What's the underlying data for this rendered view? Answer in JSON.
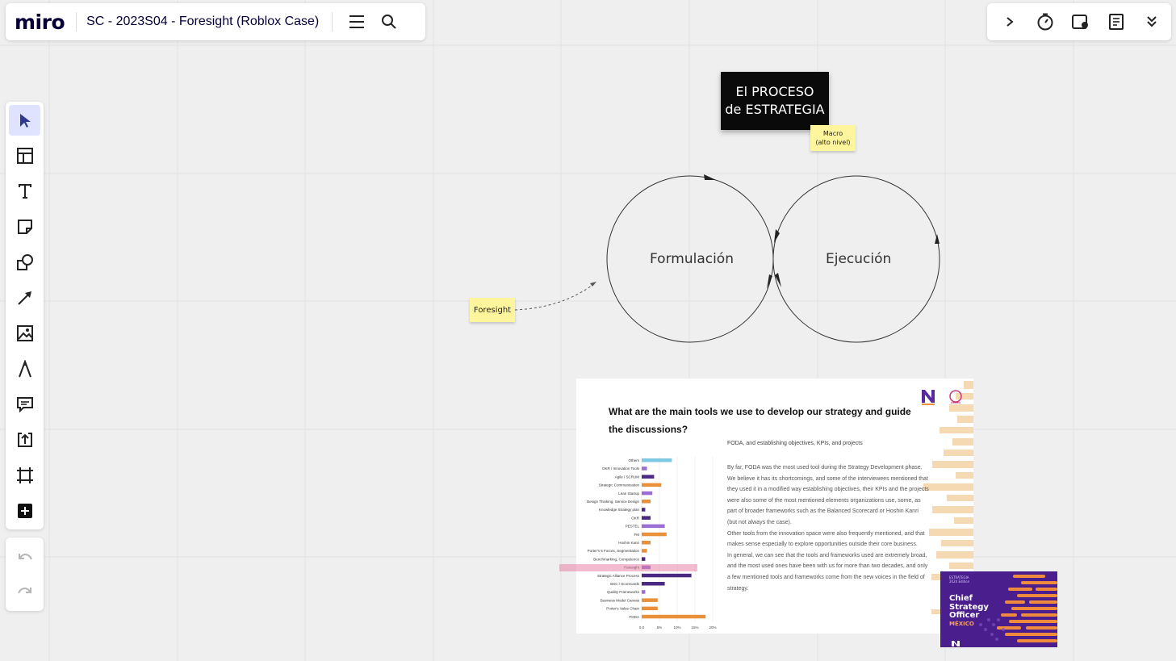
{
  "app": {
    "logo": "miro",
    "board_title": "SC - 2023S04 - Foresight (Roblox Case)"
  },
  "topbar": {
    "menu_icon": "hamburger-icon",
    "search_icon": "search-icon"
  },
  "rightbar": {
    "icons": [
      "chevron-right-icon",
      "timer-icon",
      "board-present-icon",
      "notes-icon",
      "chevrons-down-icon"
    ]
  },
  "toolbar": {
    "tools": [
      "select",
      "templates",
      "text",
      "sticky-note",
      "shapes",
      "arrow",
      "image",
      "pen",
      "comment",
      "upload",
      "frame",
      "add"
    ]
  },
  "canvas": {
    "title_card": {
      "line1": "El PROCESO",
      "line2": "de ESTRATEGIA"
    },
    "sticky_macro": {
      "line1": "Macro",
      "line2": "(alto nivel)"
    },
    "sticky_foresight": "Foresight",
    "circle_left": "Formulación",
    "circle_right": "Ejecución"
  },
  "slide": {
    "question": "What are the main tools we use to develop our strategy and guide the discussions?",
    "subtitle": "FODA, and establishing objectives, KPIs, and projects",
    "paragraphs": [
      "By far, FODA was the most used tool during the Strategy Development phase. We believe it has its shortcomings, and some of the interviewees mentioned that they used it in a modified way establishing objectives, their KPIs and the projects were also some of the most mentioned elements organizations use, some, as part of broader frameworks such as the Balanced Scorecard or Hoshin Kanri (but not always the case).",
      "Other tools from the innovation space were also frequently mentioned, and that makes sense especially to explore opportunities outside their core business.",
      "In general, we can see that the tools and frameworks used are extremely broad, and the most used ones have been with us for more than two decades, and only a few mentioned tools and frameworks come from the new voices in the field of strategy."
    ],
    "chart_data": {
      "type": "bar",
      "categories": [
        "Others",
        "OKR / Innovation Tools",
        "Agile / SCRUM",
        "Strategic Communication",
        "Lean Startup",
        "Design Thinking, Service Design",
        "Knowledge Strategy plan",
        "OKR",
        "PESTEL",
        "FM",
        "Hoshin Kanri",
        "Porter's 5 Forces, Segmentation",
        "Benchmarking, Competence",
        "Foresight",
        "Strategic Alliance Process",
        "BSC / Scorecards",
        "Quality Frameworks",
        "Business Model Canvas",
        "Porter's Value Chain",
        "FODA"
      ],
      "values": [
        8.5,
        1.5,
        3.5,
        5.5,
        3,
        2.5,
        1,
        2.5,
        6.5,
        7,
        2.5,
        1.5,
        1,
        2.5,
        14,
        6.5,
        1,
        4.5,
        4.5,
        18
      ],
      "colors": [
        "#7ec8e3",
        "#9b6dd6",
        "#4a2a82",
        "#e8913a",
        "#9b6dd6",
        "#e8913a",
        "#4a2a82",
        "#4a2a82",
        "#9b6dd6",
        "#e8913a",
        "#e8913a",
        "#e8913a",
        "#4a2a82",
        "#9b6dd6",
        "#4a2a82",
        "#4a2a82",
        "#9b6dd6",
        "#e8913a",
        "#e8913a",
        "#e8913a"
      ],
      "xticks": [
        "0.0",
        "5%",
        "10%",
        "15%",
        "20%"
      ],
      "xlim": [
        0,
        20
      ]
    }
  },
  "cso_card": {
    "top_line1": "ESTRATEGIA",
    "top_line2": "2024 Edition",
    "title_line1": "Chief",
    "title_line2": "Strategy",
    "title_line3": "Officer",
    "country": "MÉXICO"
  }
}
